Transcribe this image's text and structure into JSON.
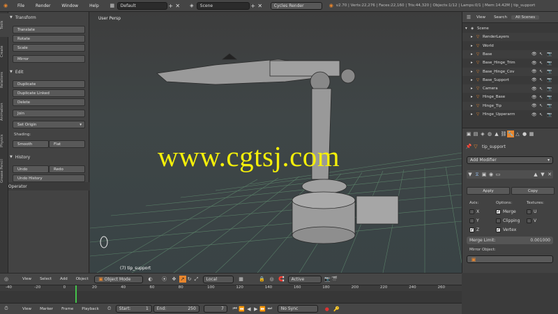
{
  "topbar": {
    "menu": [
      "File",
      "Render",
      "Window",
      "Help"
    ],
    "layout_field": "Default",
    "scene_field": "Scene",
    "render_engine": "Cycles Render",
    "info": "v2.70 | Verts:22,276 | Faces:22,160 | Tris:44,320 | Objects:1/12 | Lamps:0/1 | Mem:14.42M | tip_support"
  },
  "toolshelf": {
    "tabs": [
      "Tools",
      "Create",
      "Relations",
      "Animation",
      "Physics",
      "Grease Pencil"
    ],
    "transform": {
      "title": "Transform",
      "buttons": [
        "Translate",
        "Rotate",
        "Scale",
        "Mirror"
      ]
    },
    "edit": {
      "title": "Edit",
      "buttons": [
        "Duplicate",
        "Duplicate Linked",
        "Delete",
        "Join",
        "Set Origin"
      ]
    },
    "shading": {
      "label": "Shading:",
      "smooth": "Smooth",
      "flat": "Flat"
    },
    "history": {
      "title": "History",
      "undo": "Undo",
      "redo": "Redo",
      "undo_history": "Undo History"
    },
    "operator": {
      "title": "Operator"
    }
  },
  "viewport": {
    "label": "User Persp",
    "object_label": "(7) tip_support"
  },
  "watermark": {
    "text": "www.cgtsj.com"
  },
  "outliner": {
    "header": {
      "view": "View",
      "search": "Search",
      "all_scenes": "All Scenes"
    },
    "items": [
      {
        "label": "Scene",
        "indent": 0
      },
      {
        "label": "RenderLayers",
        "indent": 1
      },
      {
        "label": "World",
        "indent": 1
      },
      {
        "label": "Base",
        "indent": 1
      },
      {
        "label": "Base_Hinge_Trim",
        "indent": 1
      },
      {
        "label": "Base_Hinge_Cov",
        "indent": 1
      },
      {
        "label": "Base_Support",
        "indent": 1
      },
      {
        "label": "Camera",
        "indent": 1
      },
      {
        "label": "Hinge_Base",
        "indent": 1
      },
      {
        "label": "Hinge_Tip",
        "indent": 1
      },
      {
        "label": "Hinge_Upperarm",
        "indent": 1
      }
    ]
  },
  "properties": {
    "object_name": "tip_support",
    "add_modifier": "Add Modifier",
    "apply": "Apply",
    "copy": "Copy",
    "axis_label": "Axis:",
    "options_label": "Options:",
    "textures_label": "Textures:",
    "axes": [
      "X",
      "Y",
      "Z"
    ],
    "options": [
      "Merge",
      "Clipping",
      "Vertex"
    ],
    "textures": [
      "U",
      "V"
    ],
    "merge_limit_label": "Merge Limit:",
    "merge_limit_value": "0.001000",
    "mirror_object_label": "Mirror Object:"
  },
  "viewport_header": {
    "view": "View",
    "select": "Select",
    "add": "Add",
    "object": "Object",
    "mode": "Object Mode",
    "pivot": "Local",
    "snap": "Active"
  },
  "timeline": {
    "ticks": [
      "-40",
      "-20",
      "0",
      "20",
      "40",
      "60",
      "80",
      "100",
      "120",
      "140",
      "160",
      "180",
      "200",
      "220",
      "240",
      "260"
    ]
  },
  "timeline_header": {
    "view": "View",
    "marker": "Marker",
    "frame": "Frame",
    "playback": "Playback",
    "start": "Start:",
    "start_value": "1",
    "end": "End:",
    "end_value": "250",
    "current": "7",
    "sync": "No Sync"
  },
  "colors": {
    "watermark": "#f4ef0a",
    "accent_orange": "#e8862e"
  }
}
